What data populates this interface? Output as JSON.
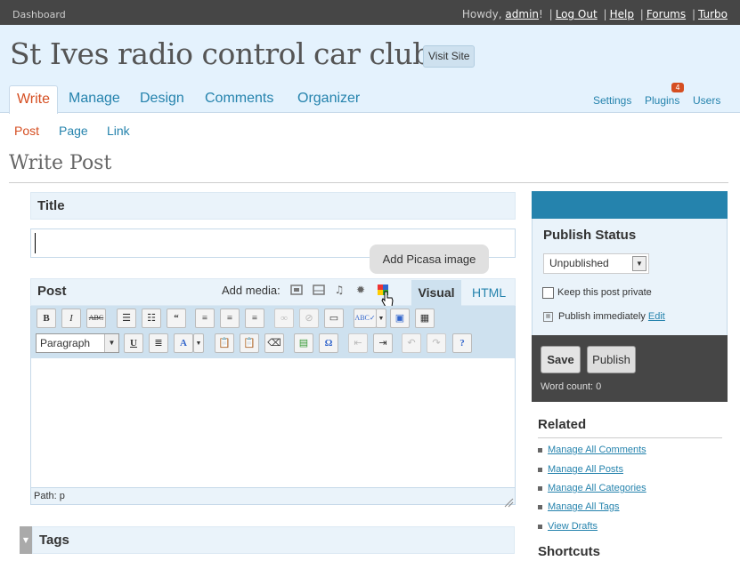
{
  "topbar": {
    "dashboard": "Dashboard",
    "howdy": "Howdy,",
    "user": "admin",
    "links": [
      "Log Out",
      "Help",
      "Forums",
      "Turbo"
    ]
  },
  "header": {
    "site_title": "St Ives radio control car club",
    "visit_site": "Visit Site",
    "tabs": [
      "Write",
      "Manage",
      "Design",
      "Comments",
      "Organizer"
    ],
    "right_links": [
      "Settings",
      "Plugins",
      "Users"
    ],
    "plugins_badge": "4"
  },
  "subtabs": [
    "Post",
    "Page",
    "Link"
  ],
  "page_title": "Write Post",
  "title_box": {
    "label": "Title",
    "value": ""
  },
  "post_box": {
    "label": "Post",
    "add_media": "Add media:",
    "tooltip": "Add Picasa image",
    "tab_visual": "Visual",
    "tab_html": "HTML",
    "format": "Paragraph",
    "path": "Path: p"
  },
  "tags_box": {
    "label": "Tags"
  },
  "publish": {
    "title": "Publish Status",
    "status": "Unpublished",
    "private_label": "Keep this post private",
    "when_text": "Publish immediately",
    "edit_link": "Edit",
    "save": "Save",
    "publish": "Publish",
    "word_count": "Word count: 0"
  },
  "related": {
    "title": "Related",
    "items": [
      "Manage All Comments",
      "Manage All Posts",
      "Manage All Categories",
      "Manage All Tags",
      "View Drafts"
    ]
  },
  "shortcuts": {
    "title": "Shortcuts"
  },
  "colors": {
    "accent": "#2583ad",
    "active": "#d54e21",
    "header_bg": "#e4f2fd",
    "dark": "#464646"
  }
}
